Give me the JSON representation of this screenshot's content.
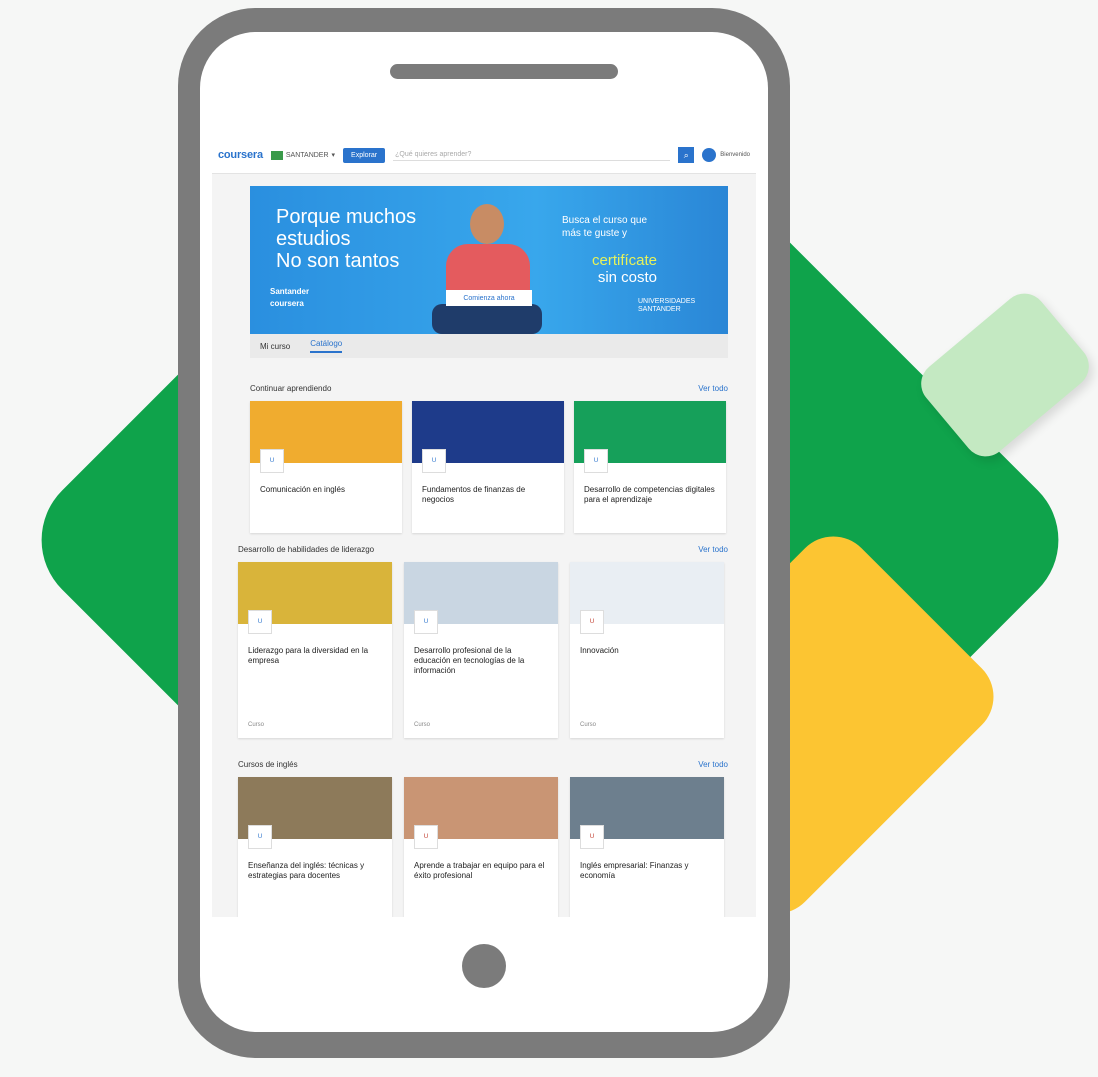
{
  "header": {
    "logo": "coursera",
    "org": "SANTANDER",
    "explore": "Explorar",
    "search_placeholder": "¿Qué quieres aprender?",
    "user": "Bienvenido"
  },
  "banner": {
    "line1": "Porque muchos",
    "line2": "estudios",
    "line3": "No son tantos",
    "brand1": "Santander",
    "brand2": "coursera",
    "right_line1": "Busca el curso que",
    "right_line2": "más te guste y",
    "cert_line1": "certifícate",
    "cert_line2": "sin costo",
    "cta": "Comienza ahora",
    "partner_logo": "UNIVERSIDADES SANTANDER"
  },
  "tabs": [
    {
      "label": "Mi curso"
    },
    {
      "label": "Catálogo"
    }
  ],
  "sections": [
    {
      "title": "Continuar aprendiendo",
      "more": "Ver todo",
      "cards": [
        {
          "title": "Comunicación en inglés",
          "color": "#f0ac2f"
        },
        {
          "title": "Fundamentos de finanzas de negocios",
          "color": "#1e3b8a"
        },
        {
          "title": "Desarrollo de competencias digitales para el aprendizaje",
          "color": "#16a05a"
        }
      ]
    },
    {
      "title": "Desarrollo de habilidades de liderazgo",
      "more": "Ver todo",
      "cards": [
        {
          "title": "Liderazgo para la diversidad en la empresa",
          "footer": "Curso",
          "color": "#d9b43a"
        },
        {
          "title": "Desarrollo profesional de la educación en tecnologías de la información",
          "footer": "Curso",
          "color": "#c9d6e2"
        },
        {
          "title": "Innovación",
          "footer": "Curso",
          "color": "#e9eef3"
        }
      ]
    },
    {
      "title": "Cursos de inglés",
      "more": "Ver todo",
      "cards": [
        {
          "title": "Enseñanza del inglés: técnicas y estrategias para docentes",
          "color": "#8d7a5a"
        },
        {
          "title": "Aprende a trabajar en equipo para el éxito profesional",
          "color": "#c99574"
        },
        {
          "title": "Inglés empresarial: Finanzas y economía",
          "color": "#6d7f8e"
        }
      ]
    }
  ]
}
